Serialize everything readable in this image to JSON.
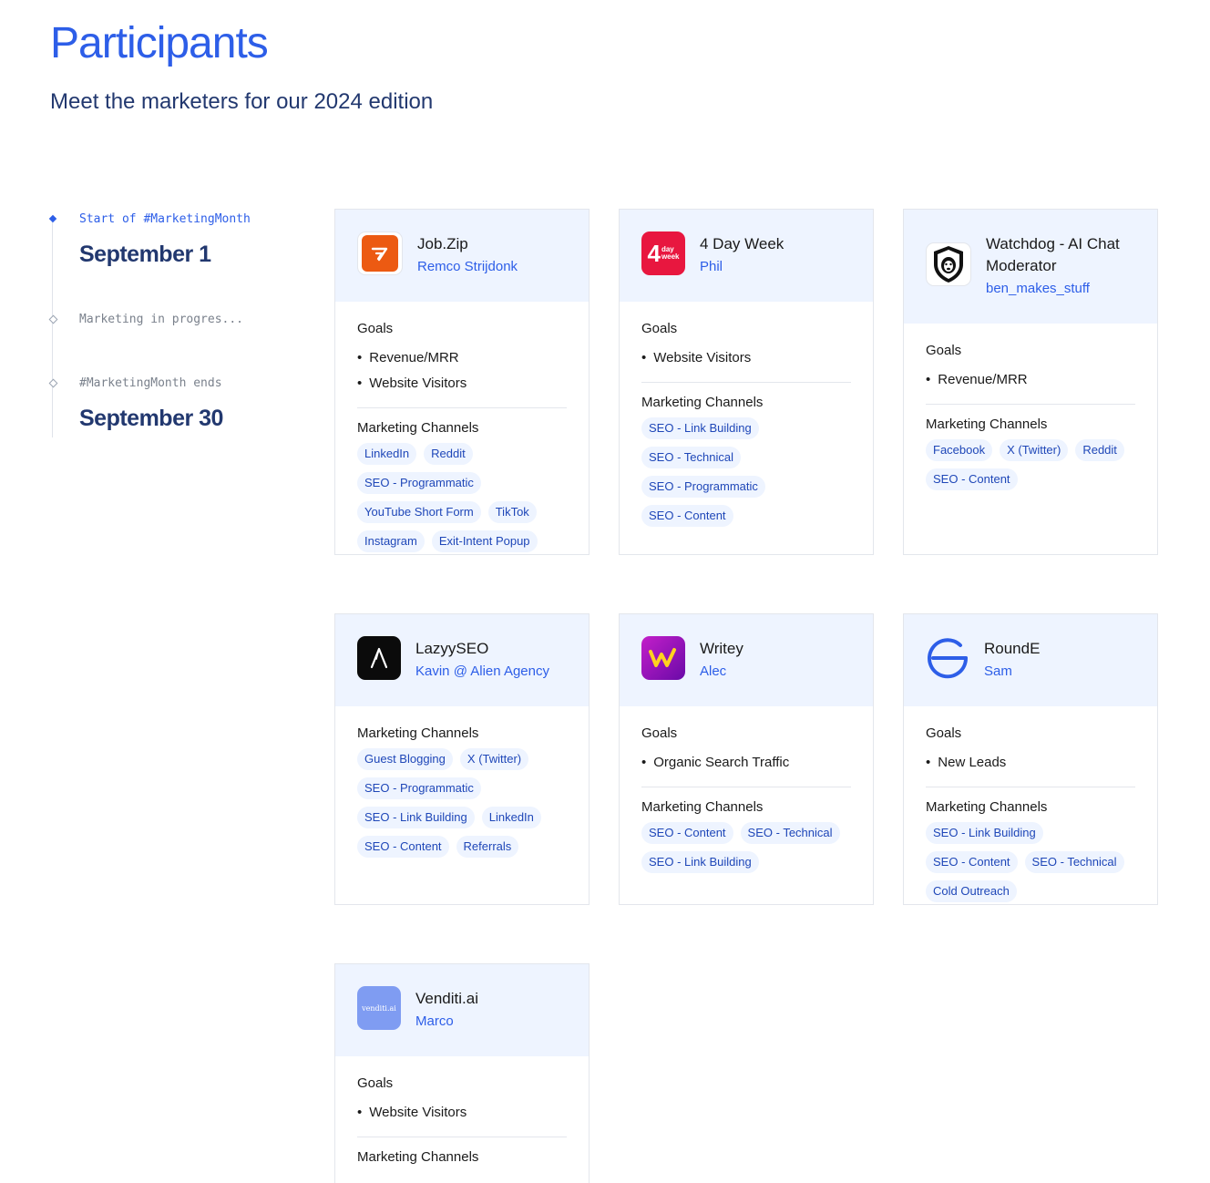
{
  "page": {
    "title": "Participants",
    "subtitle": "Meet the marketers for our 2024 edition"
  },
  "timeline": {
    "start_label": "Start of #MarketingMonth",
    "start_date": "September 1",
    "progress_label": "Marketing in progres...",
    "end_label": "#MarketingMonth ends",
    "end_date": "September 30"
  },
  "labels": {
    "goals": "Goals",
    "channels": "Marketing Channels"
  },
  "cards": [
    {
      "name": "Job.Zip",
      "owner": "Remco Strijdonk",
      "logo_icon": "jobzip-logo-icon",
      "goals": [
        "Revenue/MRR",
        "Website Visitors"
      ],
      "channels": [
        "LinkedIn",
        "Reddit",
        "SEO - Programmatic",
        "YouTube Short Form",
        "TikTok",
        "Instagram",
        "Exit-Intent Popup"
      ]
    },
    {
      "name": "4 Day Week",
      "owner": "Phil",
      "logo_icon": "4-day-week-logo-icon",
      "logo_text": {
        "big": "4",
        "small1": "day",
        "small2": "week"
      },
      "goals": [
        "Website Visitors"
      ],
      "channels": [
        "SEO - Link Building",
        "SEO - Technical",
        "SEO - Programmatic",
        "SEO - Content"
      ]
    },
    {
      "name": "Watchdog - AI Chat Moderator",
      "owner": "ben_makes_stuff",
      "logo_icon": "watchdog-shield-logo-icon",
      "goals": [
        "Revenue/MRR"
      ],
      "channels": [
        "Facebook",
        "X (Twitter)",
        "Reddit",
        "SEO - Content"
      ]
    },
    {
      "name": "LazyySEO",
      "owner": "Kavin @ Alien Agency",
      "logo_icon": "lazyyseo-logo-icon",
      "goals": [],
      "channels": [
        "Guest Blogging",
        "X (Twitter)",
        "SEO - Programmatic",
        "SEO - Link Building",
        "LinkedIn",
        "SEO - Content",
        "Referrals"
      ]
    },
    {
      "name": "Writey",
      "owner": "Alec",
      "logo_icon": "writey-logo-icon",
      "goals": [
        "Organic Search Traffic"
      ],
      "channels": [
        "SEO - Content",
        "SEO - Technical",
        "SEO - Link Building"
      ]
    },
    {
      "name": "RoundE",
      "owner": "Sam",
      "logo_icon": "rounde-logo-icon",
      "goals": [
        "New Leads"
      ],
      "channels": [
        "SEO - Link Building",
        "SEO - Content",
        "SEO - Technical",
        "Cold Outreach"
      ]
    },
    {
      "name": "Venditi.ai",
      "owner": "Marco",
      "logo_icon": "venditi-logo-icon",
      "logo_text": {
        "word": "venditi.ai"
      },
      "goals": [
        "Website Visitors"
      ],
      "channels": []
    }
  ],
  "colors": {
    "accent": "#2d5ee8",
    "heading_navy": "#22386f",
    "card_header_bg": "#eef4ff",
    "chip_bg": "#eef4ff",
    "chip_text": "#1f47b8"
  }
}
